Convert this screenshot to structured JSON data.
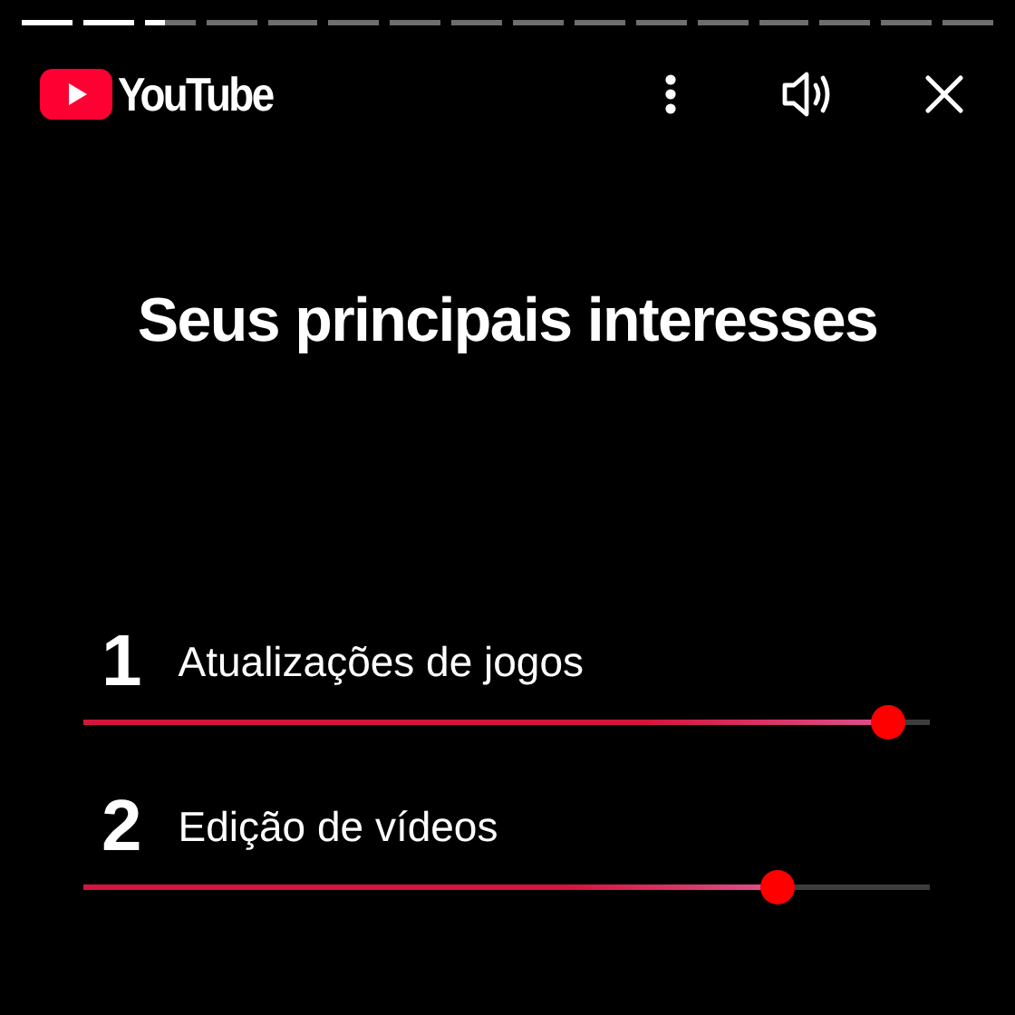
{
  "story_progress": [
    {
      "kind": "done"
    },
    {
      "kind": "done"
    },
    {
      "kind": "current"
    },
    {
      "kind": "upcoming"
    },
    {
      "kind": "upcoming"
    },
    {
      "kind": "upcoming"
    },
    {
      "kind": "upcoming"
    },
    {
      "kind": "upcoming"
    },
    {
      "kind": "upcoming"
    },
    {
      "kind": "upcoming"
    },
    {
      "kind": "upcoming"
    },
    {
      "kind": "upcoming"
    },
    {
      "kind": "upcoming"
    },
    {
      "kind": "upcoming"
    },
    {
      "kind": "upcoming"
    },
    {
      "kind": "upcoming"
    }
  ],
  "header": {
    "brand": "YouTube"
  },
  "title": "Seus principais interesses",
  "interests": [
    {
      "rank": "1",
      "label": "Atualizações de jogos",
      "level": 0.95
    },
    {
      "rank": "2",
      "label": "Edição de vídeos",
      "level": 0.82
    }
  ]
}
